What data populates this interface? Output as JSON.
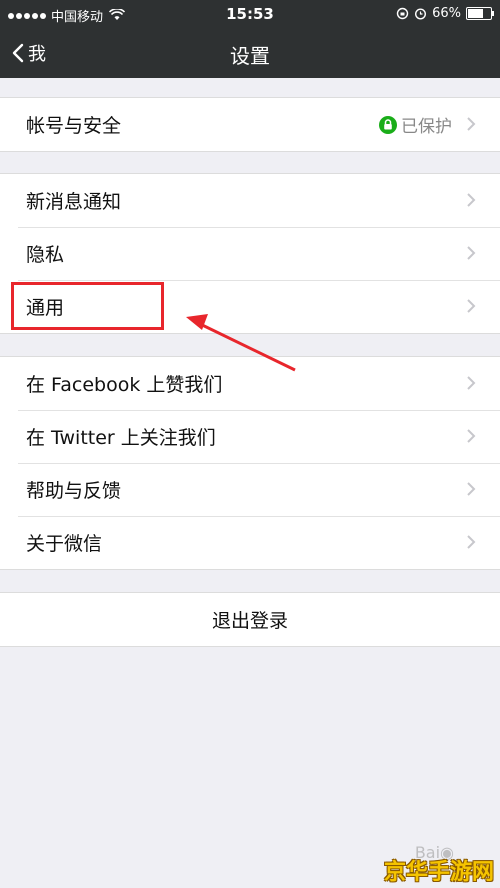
{
  "status_bar": {
    "carrier": "中国移动",
    "time": "15:53",
    "battery_text": "66%",
    "battery_level": 0.66
  },
  "nav": {
    "back_label": "我",
    "title": "设置"
  },
  "groups": {
    "account": {
      "label": "帐号与安全",
      "status": "已保护"
    },
    "notifications": {
      "label": "新消息通知"
    },
    "privacy": {
      "label": "隐私"
    },
    "general": {
      "label": "通用"
    },
    "facebook": {
      "label": "在 Facebook 上赞我们"
    },
    "twitter": {
      "label": "在 Twitter 上关注我们"
    },
    "help": {
      "label": "帮助与反馈"
    },
    "about": {
      "label": "关于微信"
    }
  },
  "logout": {
    "label": "退出登录"
  },
  "watermark": {
    "text": "京华手游网"
  },
  "colors": {
    "bar_bg": "#2e3132",
    "page_bg": "#efeff4",
    "highlight": "#e8262c",
    "lock_green": "#1aad19"
  }
}
